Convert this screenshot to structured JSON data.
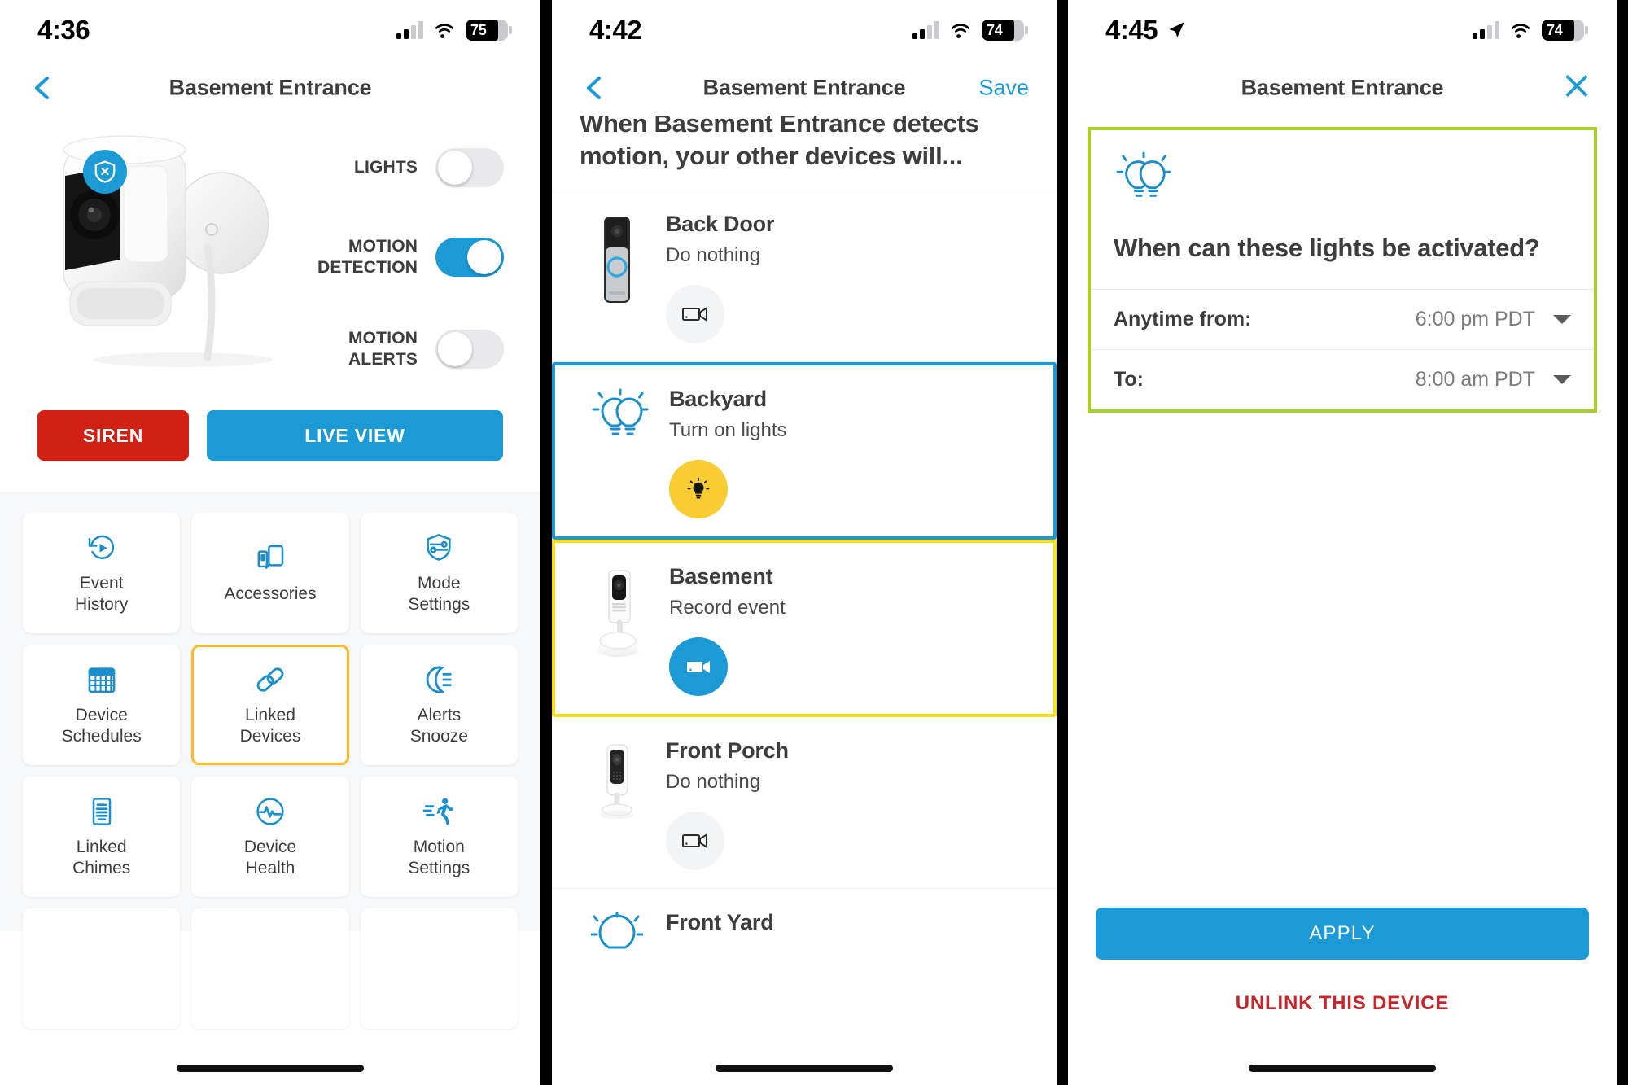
{
  "screen1": {
    "status": {
      "time": "4:36",
      "battery": "75",
      "wifi_icon": "wifi-icon",
      "signal_icon": "cellular-signal-icon"
    },
    "nav": {
      "back_icon": "chevron-left-icon",
      "title": "Basement Entrance"
    },
    "device": {
      "image_name": "ring-spotlight-cam-image",
      "badge_icon": "shield-x-icon",
      "badge_color": "#1b9ad6"
    },
    "toggles": [
      {
        "label": "LIGHTS",
        "state": "off"
      },
      {
        "label": "MOTION\nDETECTION",
        "label_line1": "MOTION",
        "label_line2": "DETECTION",
        "state": "on"
      },
      {
        "label": "MOTION\nALERTS",
        "label_line1": "MOTION",
        "label_line2": "ALERTS",
        "state": "off"
      }
    ],
    "actions": {
      "siren": "SIREN",
      "siren_color": "#d32015",
      "live_view": "LIVE VIEW",
      "live_view_color": "#1b9ad6"
    },
    "grid": [
      {
        "label_line1": "Event",
        "label_line2": "History",
        "icon": "replay-history-icon",
        "highlighted": false
      },
      {
        "label_line1": "Accessories",
        "label_line2": "",
        "icon": "devices-icon",
        "highlighted": false
      },
      {
        "label_line1": "Mode",
        "label_line2": "Settings",
        "icon": "shield-sliders-icon",
        "highlighted": false
      },
      {
        "label_line1": "Device",
        "label_line2": "Schedules",
        "icon": "calendar-icon",
        "highlighted": false
      },
      {
        "label_line1": "Linked",
        "label_line2": "Devices",
        "icon": "link-chain-icon",
        "highlighted": true
      },
      {
        "label_line1": "Alerts",
        "label_line2": "Snooze",
        "icon": "moon-snooze-icon",
        "highlighted": false
      },
      {
        "label_line1": "Linked",
        "label_line2": "Chimes",
        "icon": "document-lines-icon",
        "highlighted": false
      },
      {
        "label_line1": "Device",
        "label_line2": "Health",
        "icon": "heartbeat-icon",
        "highlighted": false
      },
      {
        "label_line1": "Motion",
        "label_line2": "Settings",
        "icon": "running-person-icon",
        "highlighted": false
      }
    ],
    "highlight_color": "#fcba25"
  },
  "screen2": {
    "status": {
      "time": "4:42",
      "battery": "74",
      "wifi_icon": "wifi-icon",
      "signal_icon": "cellular-signal-icon"
    },
    "nav": {
      "back_icon": "chevron-left-icon",
      "title": "Basement Entrance",
      "save_label": "Save"
    },
    "headline": "When Basement Entrance detects motion, your other devices will...",
    "devices": [
      {
        "name": "Back Door",
        "action": "Do nothing",
        "thumb": "ring-doorbell-image",
        "action_icon": "video-camera-icon",
        "action_style": "grey",
        "highlight": "none"
      },
      {
        "name": "Backyard",
        "action": "Turn on lights",
        "thumb": "two-bulbs-icon",
        "action_icon": "lightbulb-icon",
        "action_style": "yellow",
        "highlight": "blue"
      },
      {
        "name": "Basement",
        "action": "Record event",
        "thumb": "ring-indoor-cam-image",
        "action_icon": "video-camera-icon",
        "action_style": "blue",
        "highlight": "yellow"
      },
      {
        "name": "Front Porch",
        "action": "Do nothing",
        "thumb": "ring-stick-up-cam-image",
        "action_icon": "video-camera-icon",
        "action_style": "grey",
        "highlight": "none"
      },
      {
        "name": "Front Yard",
        "action": "",
        "thumb": "single-bulb-icon",
        "action_icon": "",
        "action_style": "none",
        "highlight": "none"
      }
    ],
    "highlight_blue": "#1b9ad6",
    "highlight_yellow": "#fbe114"
  },
  "screen3": {
    "status": {
      "time": "4:45",
      "battery": "74",
      "location_icon": "location-arrow-icon",
      "wifi_icon": "wifi-icon",
      "signal_icon": "cellular-signal-icon"
    },
    "nav": {
      "title": "Basement Entrance",
      "close_icon": "close-x-icon"
    },
    "card": {
      "icon": "two-bulbs-icon",
      "title": "When can these lights be activated?",
      "border_color": "#a8d22a",
      "rows": [
        {
          "key": "Anytime from:",
          "value": "6:00 pm PDT",
          "caret_icon": "caret-down-icon"
        },
        {
          "key": "To:",
          "value": "8:00 am PDT",
          "caret_icon": "caret-down-icon"
        }
      ]
    },
    "footer": {
      "apply_label": "APPLY",
      "apply_color": "#1b9ad6",
      "unlink_label": "UNLINK THIS DEVICE",
      "unlink_color": "#c8252a"
    }
  }
}
